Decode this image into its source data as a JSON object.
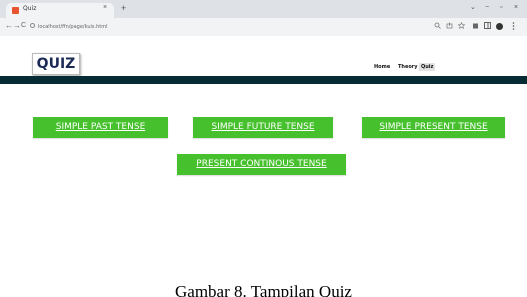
{
  "browser": {
    "tab_title": "Quiz",
    "tab_close": "×",
    "new_tab": "+",
    "url": "localhost/ffn/page/kuis.html",
    "nav_back": "←",
    "nav_forward": "→",
    "reload": "C",
    "window_controls": [
      "⌄",
      "−",
      "▫",
      "×"
    ],
    "toolbar_icons": [
      "search-icon",
      "share-icon",
      "star-icon",
      "puzzle-icon",
      "sidebar-icon",
      "profile-icon",
      "menu-icon"
    ]
  },
  "site": {
    "logo": "QUIZ",
    "nav": [
      "Home",
      "Theory",
      "Quiz"
    ],
    "accent": "#46c12d",
    "header_bar_color": "#062b33"
  },
  "quiz_buttons": [
    "SIMPLE PAST TENSE",
    "SIMPLE FUTURE TENSE",
    "SIMPLE PRESENT TENSE",
    "PRESENT CONTINOUS TENSE"
  ],
  "caption": "Gambar 8. Tampilan Quiz"
}
